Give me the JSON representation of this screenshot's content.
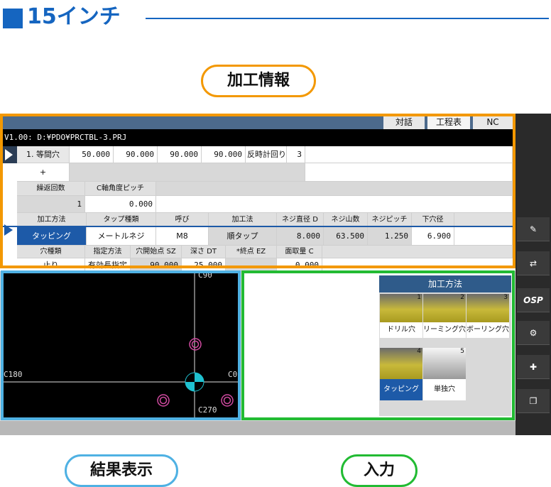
{
  "heading": {
    "title": "15インチ"
  },
  "labels": {
    "top": "加工情報",
    "bottom_left": "結果表示",
    "bottom_right": "入力"
  },
  "tabs": [
    "対話",
    "工程表",
    "NC"
  ],
  "path": "V1.00: D:¥PDO¥PRCTBL-3.PRJ",
  "row1": {
    "name": "1. 等間穴",
    "v1": "50.000",
    "v2": "90.000",
    "v3": "90.000",
    "v4": "90.000",
    "dir": "反時計回り",
    "count": "3"
  },
  "row2": {
    "plus": "+"
  },
  "row3": {
    "repeat_label": "繰返回数",
    "pitch_label": "C軸角度ピッチ",
    "repeat": "1",
    "pitch": "0.000"
  },
  "row4": {
    "headers": [
      "加工方法",
      "タップ種類",
      "呼び",
      "加工法",
      "ネジ直径 D",
      "ネジ山数",
      "ネジピッチ",
      "下穴径"
    ],
    "values": [
      "タッピング",
      "メートルネジ",
      "M8",
      "順タップ",
      "8.000",
      "63.500",
      "1.250",
      "6.900"
    ]
  },
  "row5": {
    "headers": [
      "穴種類",
      "指定方法",
      "穴開始点 SZ",
      "深さ DT",
      "*終点 EZ",
      "面取量 C"
    ],
    "values": [
      "止り",
      "有効長指定",
      "90.000",
      "25.000",
      "",
      "0.000"
    ]
  },
  "result": {
    "top": "C90",
    "left": "C180",
    "right": "C0",
    "bottom": "C270"
  },
  "method_panel": {
    "title": "加工方法",
    "items": [
      {
        "num": "1",
        "label": "ドリル穴"
      },
      {
        "num": "2",
        "label": "リーミング穴"
      },
      {
        "num": "3",
        "label": "ボーリング穴"
      },
      {
        "num": "4",
        "label": "タッピング"
      },
      {
        "num": "5",
        "label": "単独穴"
      }
    ]
  },
  "sidebar": {
    "osp": "OSP"
  }
}
